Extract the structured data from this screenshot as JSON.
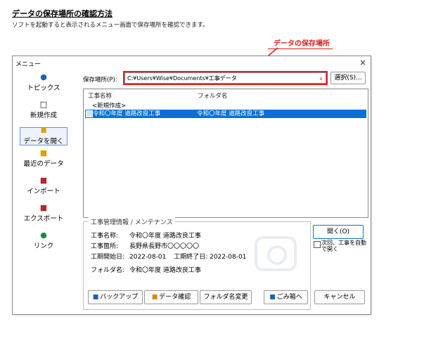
{
  "doc": {
    "title": "データの保存場所の確認方法",
    "subtitle": "ソフトを起動すると表示されるメニュー画面で保存場所を確認できます。",
    "callout": "データの保存場所",
    "accent": "#e02020"
  },
  "window": {
    "title": "メニュー",
    "close": "×"
  },
  "sidebar": {
    "items": [
      {
        "label": "トピックス",
        "icon": "info-icon"
      },
      {
        "label": "新規作成",
        "icon": "new-file-icon"
      },
      {
        "label": "データを開く",
        "icon": "open-folder-icon"
      },
      {
        "label": "最近のデータ",
        "icon": "recent-icon"
      },
      {
        "label": "インポート",
        "icon": "import-icon"
      },
      {
        "label": "エクスポート",
        "icon": "export-icon"
      },
      {
        "label": "リンク",
        "icon": "link-icon"
      }
    ]
  },
  "location": {
    "label": "保存場所(P):",
    "value": "C:¥Users¥Wise¥Documents¥工事データ",
    "select_button": "選択(S)..."
  },
  "list": {
    "headers": [
      "工事名称",
      "フォルダ名"
    ],
    "new_row": "<新規作成>",
    "selected_row": {
      "name": "令和〇年度  道路改良工事",
      "folder": "令和〇年度  道路改良工事"
    }
  },
  "info": {
    "title": "工事管理情報 / メンテナンス",
    "name_key": "工事名称:",
    "name_val": "令和〇年度  道路改良工事",
    "place_key": "工事箇所:",
    "place_val": "長野県長野市〇〇〇〇〇",
    "start_key": "工期開始日:",
    "start_val": "2022-08-01",
    "end_key": "工期終了日:",
    "end_val": "2022-08-01",
    "folder_key": "フォルダ名:",
    "folder_val": "令和〇年度  道路改良工事"
  },
  "buttons": {
    "backup": "バックアップ",
    "data_check": "データ確認",
    "rename_folder": "フォルダ名変更",
    "trash": "ごみ箱へ",
    "open": "開く(O)",
    "cancel": "キャンセル",
    "auto_open": "次回、工事を自動で開く"
  }
}
